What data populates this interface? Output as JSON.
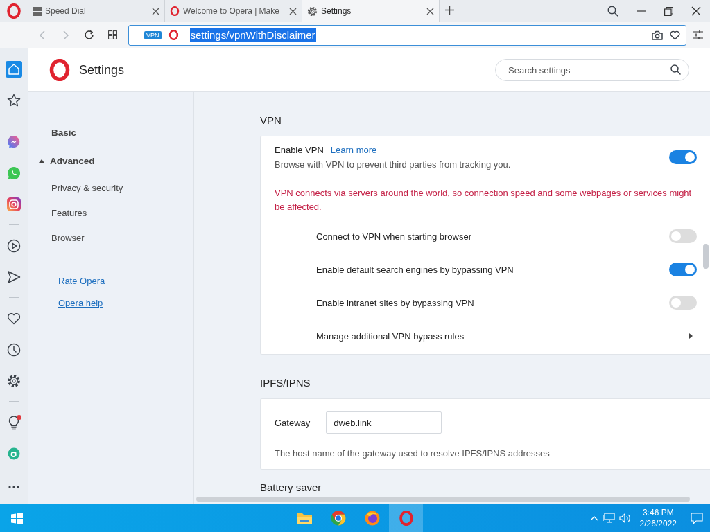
{
  "browser_tabs": [
    {
      "kind": "speed_dial",
      "title": "Speed Dial",
      "selected": false
    },
    {
      "kind": "opera",
      "title": "Welcome to Opera | Make",
      "selected": false
    },
    {
      "kind": "settings",
      "title": "Settings",
      "selected": true
    }
  ],
  "address_bar": {
    "badge": "VPN",
    "url": "settings/vpnWithDisclaimer"
  },
  "sidebar": {
    "groups": [
      [
        {
          "kind": "home",
          "selected": true
        },
        {
          "kind": "bookmarks",
          "selected": false
        }
      ],
      [
        {
          "kind": "messenger",
          "selected": false
        },
        {
          "kind": "whatsapp",
          "selected": false
        },
        {
          "kind": "instagram",
          "selected": false
        }
      ],
      [
        {
          "kind": "player",
          "selected": false
        },
        {
          "kind": "send",
          "selected": false
        }
      ],
      [
        {
          "kind": "heart",
          "selected": false
        },
        {
          "kind": "history",
          "selected": false
        },
        {
          "kind": "settings",
          "selected": false
        }
      ],
      [
        {
          "kind": "bulb",
          "selected": false,
          "notification": true
        },
        {
          "kind": "aria",
          "selected": false
        }
      ]
    ]
  },
  "header": {
    "title": "Settings",
    "search": {
      "placeholder": "Search settings"
    }
  },
  "nav": [
    {
      "kind": "heading",
      "label": "Basic"
    },
    {
      "kind": "group",
      "label": "Advanced",
      "expanded": true
    },
    {
      "kind": "item",
      "label": "Privacy & security"
    },
    {
      "kind": "item",
      "label": "Features"
    },
    {
      "kind": "item",
      "label": "Browser"
    },
    {
      "kind": "link",
      "label": "Rate Opera"
    },
    {
      "kind": "link",
      "label": "Opera help"
    }
  ],
  "vpn": {
    "title": "VPN",
    "enable": {
      "label": "Enable VPN",
      "link": "Learn more",
      "description": "Browse with VPN to prevent third parties from tracking you.",
      "on": true
    },
    "warning": "VPN connects via servers around the world, so connection speed and some webpages or services might be affected.",
    "options": [
      {
        "kind": "toggle",
        "label": "Connect to VPN when starting browser",
        "on": false
      },
      {
        "kind": "toggle",
        "label": "Enable default search engines by bypassing VPN",
        "on": true
      },
      {
        "kind": "toggle",
        "label": "Enable intranet sites by bypassing VPN",
        "on": false
      },
      {
        "kind": "submenu",
        "label": "Manage additional VPN bypass rules"
      }
    ]
  },
  "ipfs": {
    "title": "IPFS/IPNS",
    "gateway_label": "Gateway",
    "gateway_value": "dweb.link",
    "hint": "The host name of the gateway used to resolve IPFS/IPNS addresses"
  },
  "next_section": {
    "title": "Battery saver"
  },
  "taskbar": {
    "apps": [
      {
        "kind": "files",
        "active": false
      },
      {
        "kind": "chrome",
        "active": false
      },
      {
        "kind": "firefox",
        "active": false
      },
      {
        "kind": "opera",
        "active": true
      }
    ],
    "time": "3:46 PM",
    "date": "2/26/2022"
  }
}
